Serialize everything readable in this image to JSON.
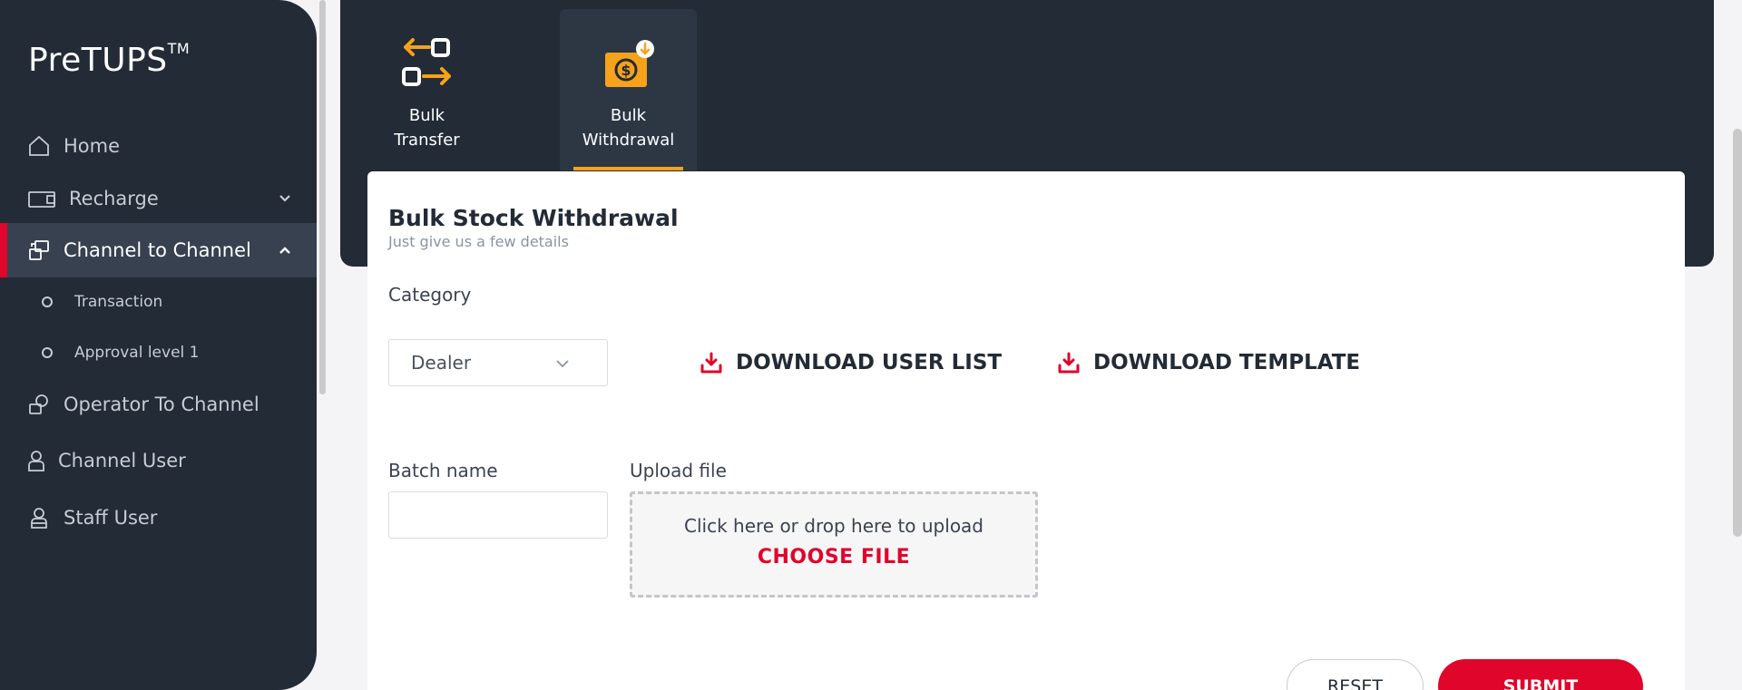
{
  "app": {
    "logo": "PreTUPS",
    "logo_tm": "TM"
  },
  "sidebar": {
    "items": [
      {
        "label": "Home",
        "icon": "home-icon"
      },
      {
        "label": "Recharge",
        "icon": "wallet-icon"
      },
      {
        "label": "Channel to Channel",
        "icon": "channel-transfer-icon"
      },
      {
        "label": "Operator To Channel",
        "icon": "operator-channel-icon"
      },
      {
        "label": "Channel User",
        "icon": "user-icon"
      },
      {
        "label": "Staff User",
        "icon": "staff-user-icon"
      }
    ],
    "sub_items": [
      "Transaction",
      "Approval level 1"
    ]
  },
  "tiles": [
    {
      "line1": "Bulk",
      "line2": "Transfer",
      "icon": "transfer-arrows-icon"
    },
    {
      "line1": "Bulk",
      "line2": "Withdrawal",
      "icon": "withdrawal-icon"
    }
  ],
  "form": {
    "title": "Bulk Stock Withdrawal",
    "subtitle": "Just give us a few details",
    "category_label": "Category",
    "category_value": "Dealer",
    "download_user_list": "DOWNLOAD USER LIST",
    "download_template": "DOWNLOAD TEMPLATE",
    "batch_label": "Batch name",
    "batch_value": "",
    "upload_label": "Upload file",
    "upload_hint": "Click here or drop here to upload",
    "choose_file": "CHOOSE FILE",
    "reset": "RESET",
    "submit": "SUBMIT"
  },
  "colors": {
    "accent": "#e0052b",
    "sidebar": "#222b36",
    "tile_accent": "#f6a21a"
  }
}
